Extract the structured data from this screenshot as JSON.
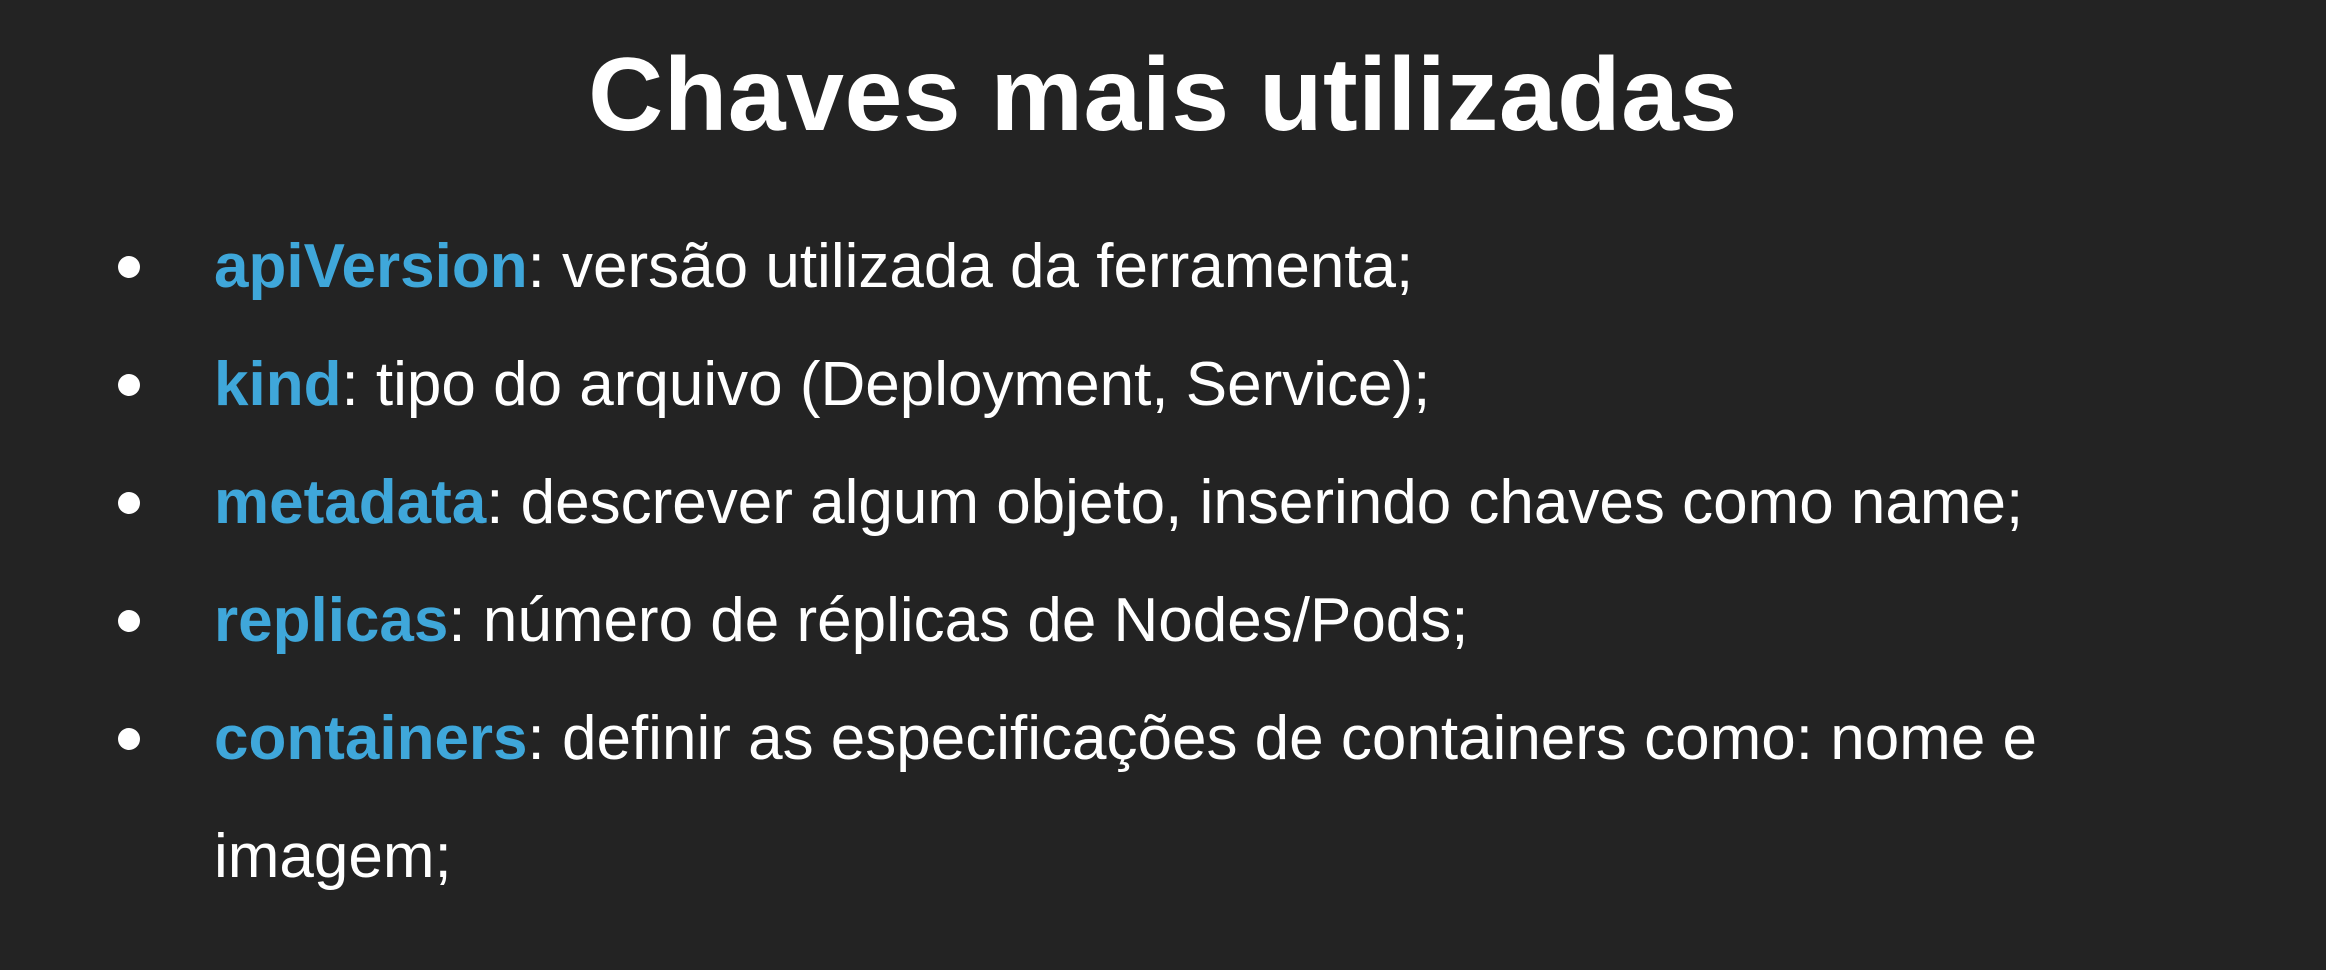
{
  "title": "Chaves mais utilizadas",
  "accent_color": "#3fa7da",
  "background_color": "#232323",
  "items": [
    {
      "key": "apiVersion",
      "text": ": versão utilizada da ferramenta;"
    },
    {
      "key": "kind",
      "text": ": tipo do arquivo (Deployment, Service);"
    },
    {
      "key": "metadata",
      "text": ": descrever algum objeto, inserindo chaves como name;"
    },
    {
      "key": "replicas",
      "text": ": número de réplicas de Nodes/Pods;"
    },
    {
      "key": "containers",
      "text": ": definir as especificações de containers como: nome e imagem;"
    }
  ]
}
